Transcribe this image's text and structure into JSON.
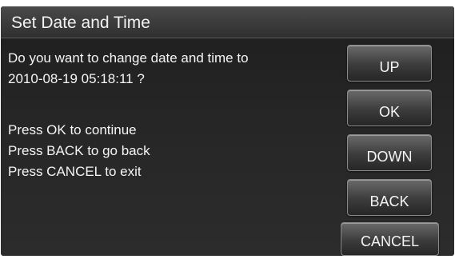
{
  "dialog": {
    "title": "Set Date and Time",
    "message_lines": [
      "Do you want to change date and time to",
      "2010-08-19 05:18:11 ?",
      "Press OK to continue",
      "Press BACK to go back",
      "Press CANCEL to exit"
    ]
  },
  "buttons": {
    "up": "UP",
    "ok": "OK",
    "down": "DOWN",
    "back": "BACK",
    "cancel": "CANCEL"
  }
}
